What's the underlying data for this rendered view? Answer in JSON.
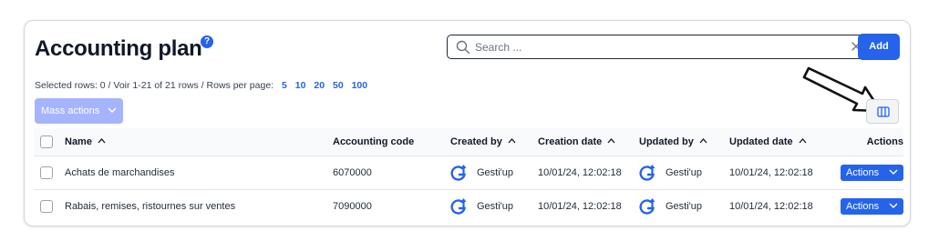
{
  "page": {
    "title": "Accounting plan",
    "help_icon": "question-circle-icon",
    "help_glyph": "?"
  },
  "search": {
    "placeholder": "Search ...",
    "value": "",
    "search_icon": "magnifier-icon",
    "clear_icon": "close-icon"
  },
  "toolbar": {
    "add_label": "Add",
    "mass_actions_label": "Mass actions",
    "columns_icon": "columns-icon"
  },
  "info": {
    "selected_text": "Selected rows: 0 /",
    "range_text": "Voir 1-21 of 21 rows /",
    "rows_per_page_label": "Rows per page:",
    "rows_per_page_options": [
      "5",
      "10",
      "20",
      "50",
      "100"
    ]
  },
  "table": {
    "columns": [
      "Name",
      "Accounting code",
      "Created by",
      "Creation date",
      "Updated by",
      "Updated date",
      "Actions"
    ],
    "rows": [
      {
        "name": "Achats de marchandises",
        "code": "6070000",
        "created_by": "Gesti'up",
        "creation_date": "10/01/24, 12:02:18",
        "updated_by": "Gesti'up",
        "updated_date": "10/01/24, 12:02:18",
        "actions_label": "Actions"
      },
      {
        "name": "Rabais, remises, ristournes sur ventes",
        "code": "7090000",
        "created_by": "Gesti'up",
        "creation_date": "10/01/24, 12:02:18",
        "updated_by": "Gesti'up",
        "updated_date": "10/01/24, 12:02:18",
        "actions_label": "Actions"
      }
    ]
  },
  "colors": {
    "accent": "#2563eb",
    "accent_disabled": "#a5b4fc",
    "text": "#111827",
    "border": "#d1d5db"
  }
}
